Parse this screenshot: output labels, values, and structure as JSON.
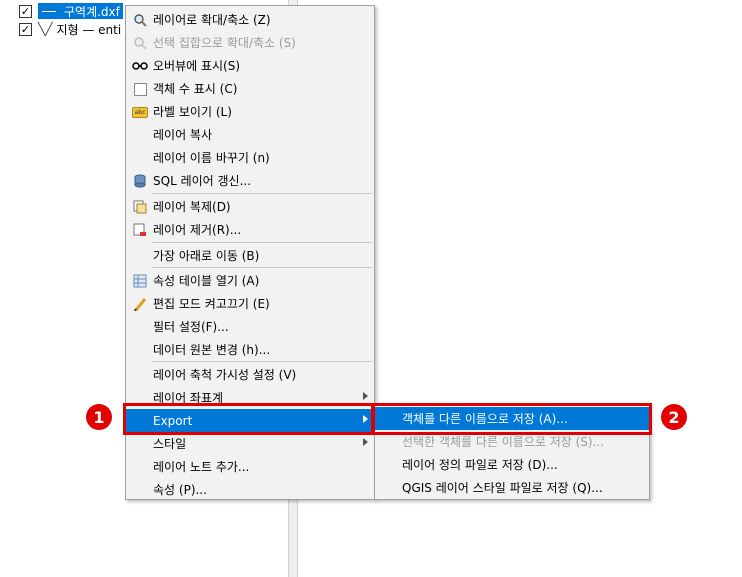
{
  "layers": [
    {
      "name": "구역계.dxf",
      "checked": "✓"
    },
    {
      "name": "지형 — enti",
      "checked": "✓"
    }
  ],
  "context_menu": {
    "items": [
      {
        "label": "레이어로 확대/축소 (Z)",
        "icon": "zoom-layer-icon"
      },
      {
        "label": "선택 집합으로 확대/축소 (S)",
        "icon": "zoom-selection-icon"
      },
      {
        "label": "오버뷰에 표시(S)",
        "icon": "overview-icon"
      },
      {
        "label": "객체 수 표시 (C)",
        "icon": "checkbox-icon"
      },
      {
        "label": "라벨 보이기 (L)",
        "icon": "label-icon"
      },
      {
        "label": "레이어 복사",
        "icon": ""
      },
      {
        "label": "레이어 이름 바꾸기 (n)",
        "icon": ""
      },
      {
        "label": "SQL 레이어 갱신...",
        "icon": "database-icon"
      },
      {
        "label": "레이어 복제(D)",
        "icon": "duplicate-icon"
      },
      {
        "label": "레이어 제거(R)...",
        "icon": "remove-layer-icon"
      },
      {
        "label": "가장 아래로 이동 (B)",
        "icon": ""
      },
      {
        "label": "속성 테이블 열기 (A)",
        "icon": "table-icon"
      },
      {
        "label": "편집 모드 켜고끄기 (E)",
        "icon": "pencil-icon"
      },
      {
        "label": "필터 설정(F)...",
        "icon": ""
      },
      {
        "label": "데이터 원본 변경 (h)...",
        "icon": ""
      },
      {
        "label": "레이어 축척 가시성 설정 (V)",
        "icon": ""
      },
      {
        "label": "레이어 좌표계",
        "icon": ""
      },
      {
        "label": "Export",
        "icon": ""
      },
      {
        "label": "스타일",
        "icon": ""
      },
      {
        "label": "레이어 노트 추가...",
        "icon": ""
      },
      {
        "label": "속성 (P)...",
        "icon": ""
      }
    ]
  },
  "export_submenu": {
    "items": [
      {
        "label": "객체를 다른 이름으로 저장 (A)..."
      },
      {
        "label": "선택한 객체를 다른 이름으로 저장 (S)..."
      },
      {
        "label": "레이어 정의 파일로 저장 (D)..."
      },
      {
        "label": "QGIS 레이어 스타일 파일로 저장 (Q)..."
      }
    ]
  },
  "annotations": {
    "badge1": "1",
    "badge2": "2"
  },
  "colors": {
    "highlight": "#0078d7",
    "annotation_red": "#e00000"
  }
}
